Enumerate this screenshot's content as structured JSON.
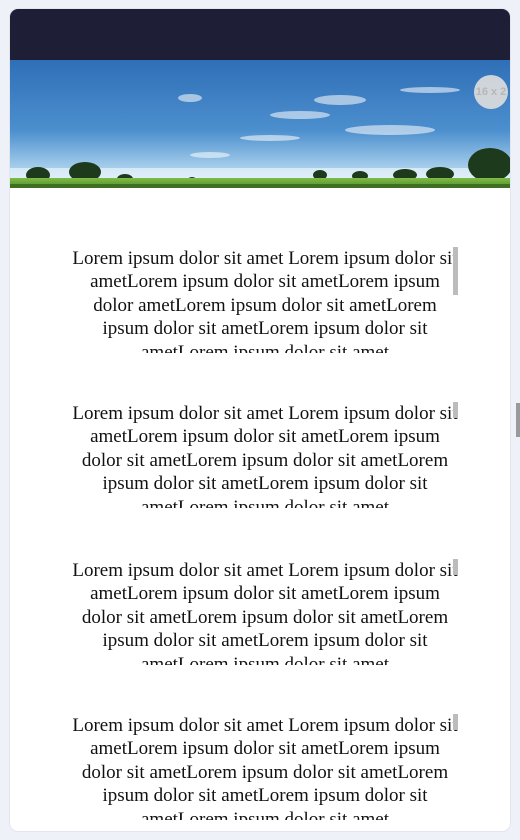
{
  "banner": {
    "badge_text": "16 x 2",
    "sky_top_color": "#2f6fb7",
    "sky_bottom_color": "#cfe6f5",
    "grass_color": "#6bab3b"
  },
  "items": [
    {
      "text": "Lorem ipsum dolor sit amet Lorem ipsum dolor sit ametLorem ipsum dolor sit ametLorem ipsum dolor ametLorem ipsum dolor sit ametLorem ipsum dolor sit ametLorem ipsum dolor sit ametLorem ipsum dolor sit amet"
    },
    {
      "text": "Lorem ipsum dolor sit amet Lorem ipsum dolor sit ametLorem ipsum dolor sit ametLorem ipsum dolor sit ametLorem ipsum dolor sit ametLorem ipsum dolor sit ametLorem ipsum dolor sit ametLorem ipsum dolor sit amet"
    },
    {
      "text": "Lorem ipsum dolor sit amet Lorem ipsum dolor sit ametLorem ipsum dolor sit ametLorem ipsum dolor sit ametLorem ipsum dolor sit ametLorem ipsum dolor sit ametLorem ipsum dolor sit ametLorem ipsum dolor sit amet"
    },
    {
      "text": "Lorem ipsum dolor sit amet Lorem ipsum dolor sit ametLorem ipsum dolor sit ametLorem ipsum dolor sit ametLorem ipsum dolor sit ametLorem ipsum dolor sit ametLorem ipsum dolor sit ametLorem ipsum dolor sit amet"
    }
  ]
}
